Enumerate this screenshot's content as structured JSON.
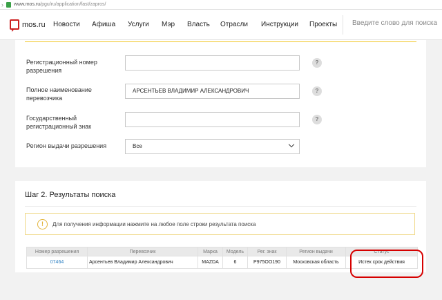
{
  "browser": {
    "url_host": "www.mos.ru",
    "url_path": "/pgu/ru/application/fast/zapros/"
  },
  "header": {
    "logo_text": "mos.ru",
    "nav": [
      "Новости",
      "Афиша",
      "Услуги",
      "Мэр",
      "Власть",
      "Отрасли",
      "Инструкции",
      "Проекты"
    ],
    "search_placeholder": "Введите слово для поиска"
  },
  "form": {
    "fields": [
      {
        "label": "Регистрационный номер разрешения",
        "value": ""
      },
      {
        "label": "Полное наименование перевозчика",
        "value": "АРСЕНТЬЕВ ВЛАДИМИР АЛЕКСАНДРОВИЧ"
      },
      {
        "label": "Государственный регистрационный знак",
        "value": ""
      }
    ],
    "region": {
      "label": "Регион выдачи разрешения",
      "value": "Все"
    },
    "help_glyph": "?"
  },
  "results": {
    "title": "Шаг 2. Результаты поиска",
    "info_icon": "!",
    "info_text": "Для получения информации нажмите на любое поле строки результата поиска",
    "columns": [
      "Номер разрешения",
      "Перевозчик",
      "Марка",
      "Модель",
      "Рег. знак",
      "Регион выдачи",
      "Статус"
    ],
    "rows": [
      [
        "07464",
        "Арсентьев Владимир Александрович",
        "MAZDA",
        "6",
        "Р975ОО190",
        "Московская область",
        "Истек срок действия"
      ]
    ]
  }
}
